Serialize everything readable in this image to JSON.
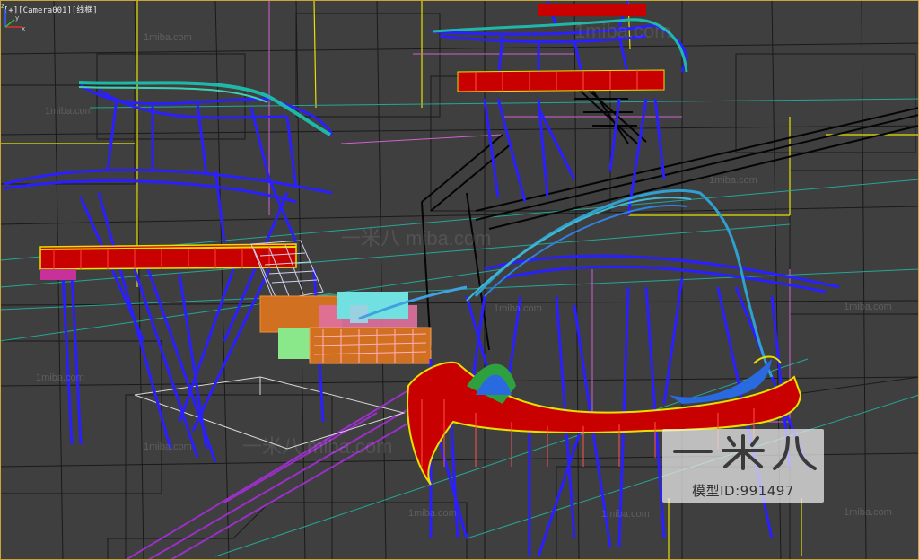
{
  "viewport": {
    "label_plus": "[+]",
    "label_camera": "[Camera001]",
    "label_mode": "[线框]",
    "background_color": "#3f3f3f",
    "frame_color": "#c9a53b"
  },
  "watermarks": {
    "site_text_large": "1miba.com",
    "site_text_small": "1miba.com",
    "brand_cn_large": "一米八 miba.com"
  },
  "brand_badge": {
    "logo_text": "一米八",
    "model_id": "模型ID:991497"
  },
  "wire_colors": {
    "blue": "#2a1fff",
    "red": "#d40000",
    "cyan": "#1fb8a8",
    "yellow": "#e8e000",
    "black": "#050505",
    "magenta": "#e000e0",
    "green": "#7fe07f",
    "orange": "#e07a00",
    "white": "#e0e0e0"
  },
  "axis_gizmo": {
    "x_label": "x",
    "y_label": "y",
    "z_label": "z"
  }
}
